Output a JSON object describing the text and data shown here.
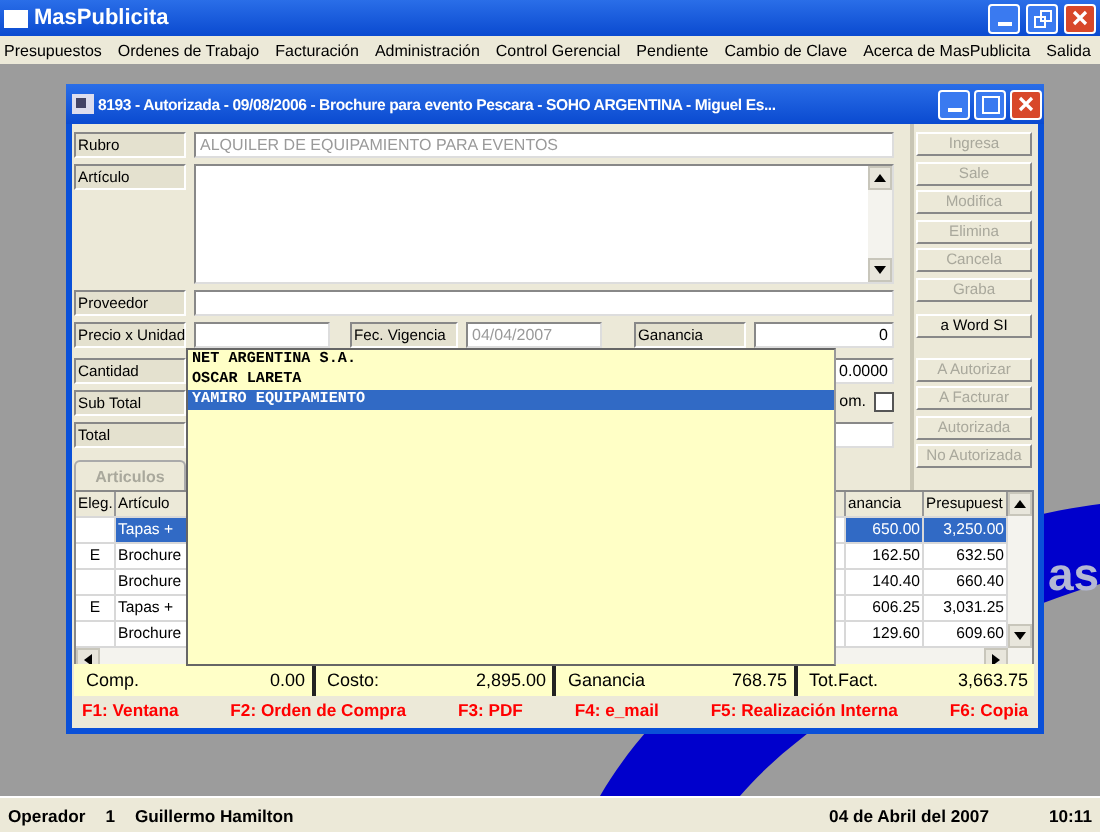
{
  "app": {
    "title": "MasPublicita"
  },
  "menu": [
    "Presupuestos",
    "Ordenes de Trabajo",
    "Facturación",
    "Administración",
    "Control Gerencial",
    "Pendiente",
    "Cambio de Clave",
    "Acerca de MasPublicita",
    "Salida"
  ],
  "window": {
    "title": "8193 - Autorizada  - 09/08/2006 - Brochure para evento Pescara - SOHO ARGENTINA - Miguel Es..."
  },
  "form": {
    "rubro": {
      "label": "Rubro",
      "value": "ALQUILER DE EQUIPAMIENTO PARA EVENTOS"
    },
    "articulo": {
      "label": "Artículo"
    },
    "proveedor": {
      "label": "Proveedor"
    },
    "precio": {
      "label": "Precio x Unidad"
    },
    "fec_vigencia": {
      "label": "Fec. Vigencia",
      "value": "04/04/2007"
    },
    "ganancia": {
      "label": "Ganancia",
      "value": "0"
    },
    "cantidad": {
      "label": "Cantidad",
      "value": "0.0000"
    },
    "sub_total": {
      "label": "Sub Total",
      "check_label": "om.",
      "checked": false
    },
    "total": {
      "label": "Total"
    }
  },
  "dropdown": {
    "items": [
      {
        "text": "NET ARGENTINA S.A.",
        "selected": false
      },
      {
        "text": "OSCAR LARETA",
        "selected": false
      },
      {
        "text": "YAMIRO EQUIPAMIENTO",
        "selected": true
      }
    ]
  },
  "buttons": [
    {
      "label": "Ingresa",
      "disabled": true
    },
    {
      "label": "Sale",
      "disabled": true
    },
    {
      "label": "Modifica",
      "disabled": true
    },
    {
      "label": "Elimina",
      "disabled": true
    },
    {
      "label": "Cancela",
      "disabled": true
    },
    {
      "label": "Graba",
      "disabled": true
    },
    {
      "label": "a Word SI",
      "disabled": false
    },
    {
      "label": "A Autorizar",
      "disabled": true
    },
    {
      "label": "A Facturar",
      "disabled": true
    },
    {
      "label": "Autorizada",
      "disabled": true
    },
    {
      "label": "No Autorizada",
      "disabled": true
    }
  ],
  "tabs": [
    {
      "label": "Articulos",
      "disabled": true
    }
  ],
  "grid": {
    "columns": [
      "Eleg.",
      "Artículo",
      "anancia",
      "Presupuest"
    ],
    "rows": [
      {
        "articulo": "Tapas +",
        "ganancia": "650.00",
        "presupuesto": "3,250.00",
        "selected": true
      },
      {
        "eleg": "E",
        "articulo": "Brochure",
        "ganancia": "162.50",
        "presupuesto": "632.50",
        "selected": false
      },
      {
        "articulo": "Brochure",
        "ganancia": "140.40",
        "presupuesto": "660.40",
        "selected": false
      },
      {
        "eleg": "E",
        "articulo": "Tapas +",
        "ganancia": "606.25",
        "presupuesto": "3,031.25",
        "selected": false
      },
      {
        "articulo": "Brochure",
        "ganancia": "129.60",
        "presupuesto": "609.60",
        "selected": false
      }
    ]
  },
  "summary": [
    {
      "label": "Comp.",
      "value": "0.00"
    },
    {
      "label": "Costo:",
      "value": "2,895.00"
    },
    {
      "label": "Ganancia",
      "value": "768.75"
    },
    {
      "label": "Tot.Fact.",
      "value": "3,663.75"
    }
  ],
  "function_keys": [
    "F1: Ventana",
    "F2: Orden de Compra",
    "F3: PDF",
    "F4: e_mail",
    "F5: Realización Interna",
    "F6: Copia"
  ],
  "background_logo": "as",
  "status_bar": {
    "operator_label": "Operador",
    "operator_id": "1",
    "operator_name": "Guillermo Hamilton",
    "date": "04 de Abril del 2007",
    "time": "10:11"
  }
}
